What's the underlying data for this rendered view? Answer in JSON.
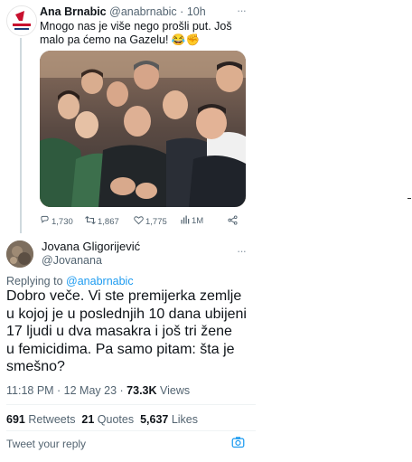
{
  "tweet": {
    "display_name": "Ana Brnabic",
    "handle": "@anabrnabic",
    "separator": "·",
    "time": "10h",
    "text_line1": "Mnogo nas je više nego prošli put. Još",
    "text_line2": "malo pa ćemo na Gazelu! 😂✊",
    "stats": {
      "replies": "1,730",
      "retweets": "1,867",
      "likes": "1,775",
      "views": "1M"
    }
  },
  "reply": {
    "display_name": "Jovana Gligorijević",
    "handle": "@Jovanana",
    "replying_prefix": "Replying to",
    "replying_to": "@anabrnabic",
    "body_lines": [
      "Dobro veče. Vi ste premijerka zemlje",
      "u kojoj je u poslednjih 10 dana ubijeni",
      "17 ljudi u dva masakra i još tri žene",
      "u femicidima. Pa samo pitam: šta je",
      "smešno?"
    ],
    "timestamp": "11:18 PM · 12 May 23 ·",
    "views_count": "73.3K",
    "views_label": "Views",
    "retweets_count": "691",
    "retweets_label": "Retweets",
    "quotes_count": "21",
    "quotes_label": "Quotes",
    "likes_count": "5,637",
    "likes_label": "Likes"
  },
  "composer": {
    "placeholder": "Tweet your reply"
  },
  "icons": {
    "reply": "reply-icon",
    "retweet": "retweet-icon",
    "like": "heart-icon",
    "views": "views-chart-icon",
    "share": "share-icon",
    "more": "more-icon",
    "image": "image-icon"
  },
  "colors": {
    "link": "#1d9bf0",
    "muted": "#536471",
    "text": "#0f1419"
  }
}
